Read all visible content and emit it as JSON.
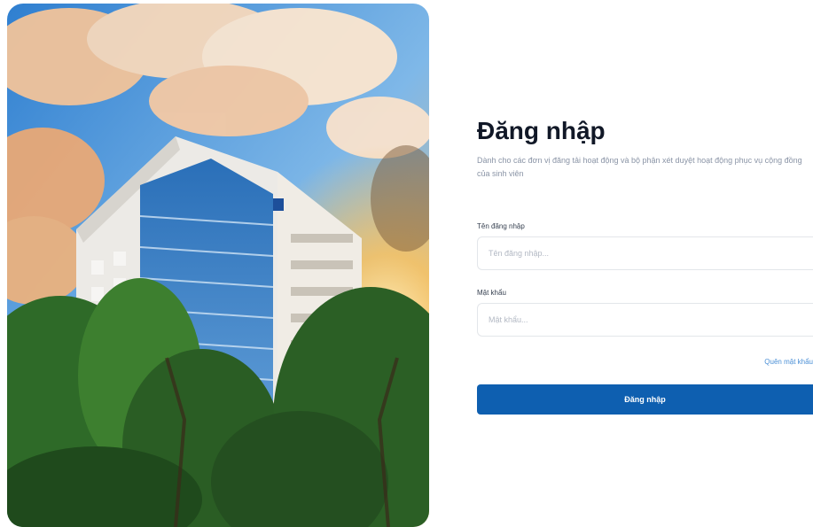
{
  "login": {
    "title": "Đăng nhập",
    "subtitle": "Dành cho các đơn vị đăng tải hoạt động và bộ phận xét duyệt hoạt động phục vụ cộng đồng của sinh viên",
    "username_label": "Tên đăng nhập",
    "username_placeholder": "Tên đăng nhập...",
    "username_value": "",
    "password_label": "Mật khẩu",
    "password_placeholder": "Mật khẩu...",
    "password_value": "",
    "forgot_password": "Quên mật khẩu",
    "submit_label": "Đăng nhập"
  },
  "colors": {
    "primary": "#0e5fb0",
    "link": "#4a8fd6",
    "sky": "#3c8fd9",
    "foliage": "#2f6b2a"
  },
  "icons": {
    "hero": "campus-building-photo"
  }
}
